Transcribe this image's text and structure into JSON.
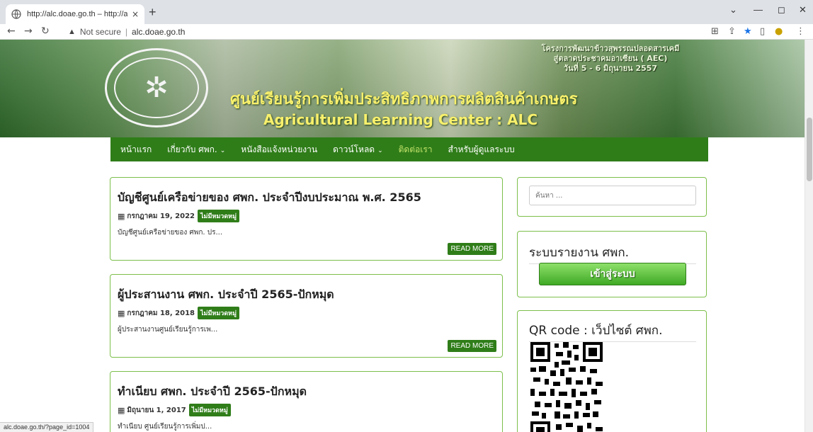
{
  "browser": {
    "tab_title": "http://alc.doae.go.th – http://alc.",
    "tab_close": "×",
    "new_tab": "+",
    "not_secure": "Not secure",
    "url": "alc.doae.go.th",
    "status_url": "alc.doae.go.th/?page_id=1004"
  },
  "banner": {
    "title_thai": "ศูนย์เรียนรู้การเพิ่มประสิทธิภาพการผลิตสินค้าเกษตร",
    "title_eng": "Agricultural Learning Center  : ALC",
    "project_line1": "โครงการพัฒนาข้าวสุพรรณปลอดสารเคมี",
    "project_line2": "สู่ตลาดประชาคมอาเซียน ( AEC)",
    "project_line3": "วันที่ 5 - 6 มิถุนายน 2557"
  },
  "nav": {
    "items": [
      {
        "label": "หน้าแรก",
        "dropdown": false
      },
      {
        "label": "เกี่ยวกับ ศพก.",
        "dropdown": true
      },
      {
        "label": "หนังสือแจ้งหน่วยงาน",
        "dropdown": false
      },
      {
        "label": "ดาวน์โหลด",
        "dropdown": true
      },
      {
        "label": "ติดต่อเรา",
        "dropdown": false
      },
      {
        "label": "สำหรับผู้ดูแลระบบ",
        "dropdown": false
      }
    ]
  },
  "posts": [
    {
      "title": "บัญชีศูนย์เครือข่ายของ ศพก. ประจำปีงบประมาณ พ.ศ. 2565",
      "date": "กรกฎาคม 19, 2022",
      "category": "ไม่มีหมวดหมู่",
      "excerpt": "บัญชีศูนย์เครือข่ายของ ศพก. ปร...",
      "read_more": "READ MORE"
    },
    {
      "title": "ผู้ประสานงาน ศพก. ประจำปี 2565-ปักหมุด",
      "date": "กรกฎาคม 18, 2018",
      "category": "ไม่มีหมวดหมู่",
      "excerpt": "ผู้ประสานงานศูนย์เรียนรู้การเพ...",
      "read_more": "READ MORE"
    },
    {
      "title": "ทำเนียบ ศพก. ประจำปี 2565-ปักหมุด",
      "date": "มิถุนายน 1, 2017",
      "category": "ไม่มีหมวดหมู่",
      "excerpt": "ทำเนียบ ศูนย์เรียนรู้การเพิ่มป..."
    }
  ],
  "sidebar": {
    "search_placeholder": "ค้นหา ...",
    "report_title": "ระบบรายงาน ศพก.",
    "login_button": "เข้าสู่ระบบ",
    "qr_title": "QR code : เว็ปไซต์ ศพก."
  },
  "colors": {
    "nav_green": "#2f7d19",
    "border_green": "#7cbf4a",
    "banner_yellow": "#f8f06c"
  }
}
